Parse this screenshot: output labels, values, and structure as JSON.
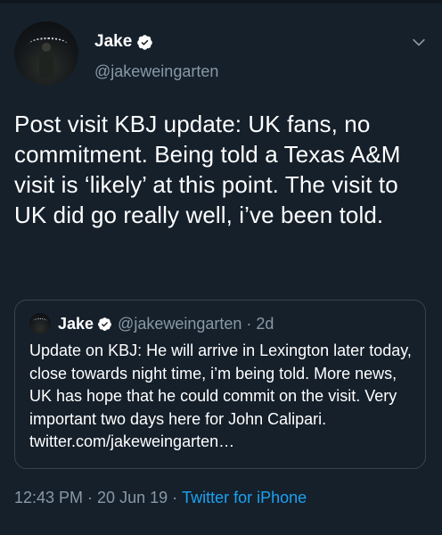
{
  "author": {
    "display_name": "Jake",
    "handle": "@jakeweingarten",
    "verified_icon": "verified-badge-icon",
    "avatar": "profile-avatar"
  },
  "tweet": {
    "text": "Post visit KBJ update: UK fans, no commitment. Being told a Texas A&M visit is ‘likely’ at this point. The visit to UK did go really well, i’ve been told."
  },
  "quoted_tweet": {
    "display_name": "Jake",
    "handle": "@jakeweingarten",
    "separator": "·",
    "time": "2d",
    "text": "Update on KBJ: He will arrive in Lexington later today, close towards night time, i’m being told. More news, UK has hope that he could commit on the visit. Very important two days here for John Calipari. twitter.com/jakeweingarten…"
  },
  "meta": {
    "time": "12:43 PM",
    "sep1": "·",
    "date": "20 Jun 19",
    "sep2": "·",
    "source": "Twitter for iPhone"
  },
  "colors": {
    "background": "#15202b",
    "secondary_text": "#8899a6",
    "accent": "#1da1f2",
    "border": "#38444d"
  }
}
